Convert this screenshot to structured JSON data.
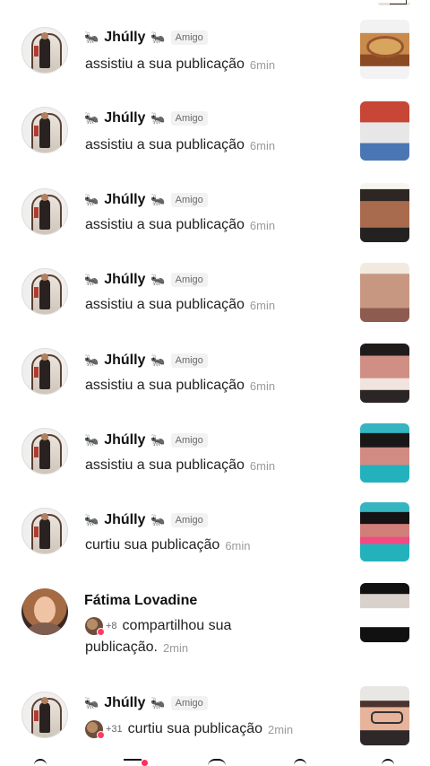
{
  "notifications": [
    {
      "name": "Jhúlly",
      "badge": "Amigo",
      "action": "assistiu a sua publicação",
      "time": "6min",
      "thumb": "t-food"
    },
    {
      "name": "Jhúlly",
      "badge": "Amigo",
      "action": "assistiu a sua publicação",
      "time": "6min",
      "thumb": "t-red"
    },
    {
      "name": "Jhúlly",
      "badge": "Amigo",
      "action": "assistiu a sua publicação",
      "time": "6min",
      "thumb": "t-face1"
    },
    {
      "name": "Jhúlly",
      "badge": "Amigo",
      "action": "assistiu a sua publicação",
      "time": "6min",
      "thumb": "t-face2"
    },
    {
      "name": "Jhúlly",
      "badge": "Amigo",
      "action": "assistiu a sua publicação",
      "time": "6min",
      "thumb": "t-face3"
    },
    {
      "name": "Jhúlly",
      "badge": "Amigo",
      "action": "assistiu a sua publicação",
      "time": "6min",
      "thumb": "t-face4"
    },
    {
      "name": "Jhúlly",
      "badge": "Amigo",
      "action": "curtiu sua publicação",
      "time": "6min",
      "thumb": "t-face5"
    },
    {
      "name": "Fátima Lovadine",
      "badge": "",
      "count": "+8",
      "action1": "compartilhou sua",
      "action2": "publicação.",
      "time": "2min",
      "thumb": "t-meme"
    },
    {
      "name": "Jhúlly",
      "badge": "Amigo",
      "count": "+31",
      "action": "curtiu sua publicação",
      "time": "2min",
      "thumb": "t-glasses"
    }
  ],
  "icons": {
    "ant": "🐜",
    "notification_dot": "#ff2e5c"
  }
}
